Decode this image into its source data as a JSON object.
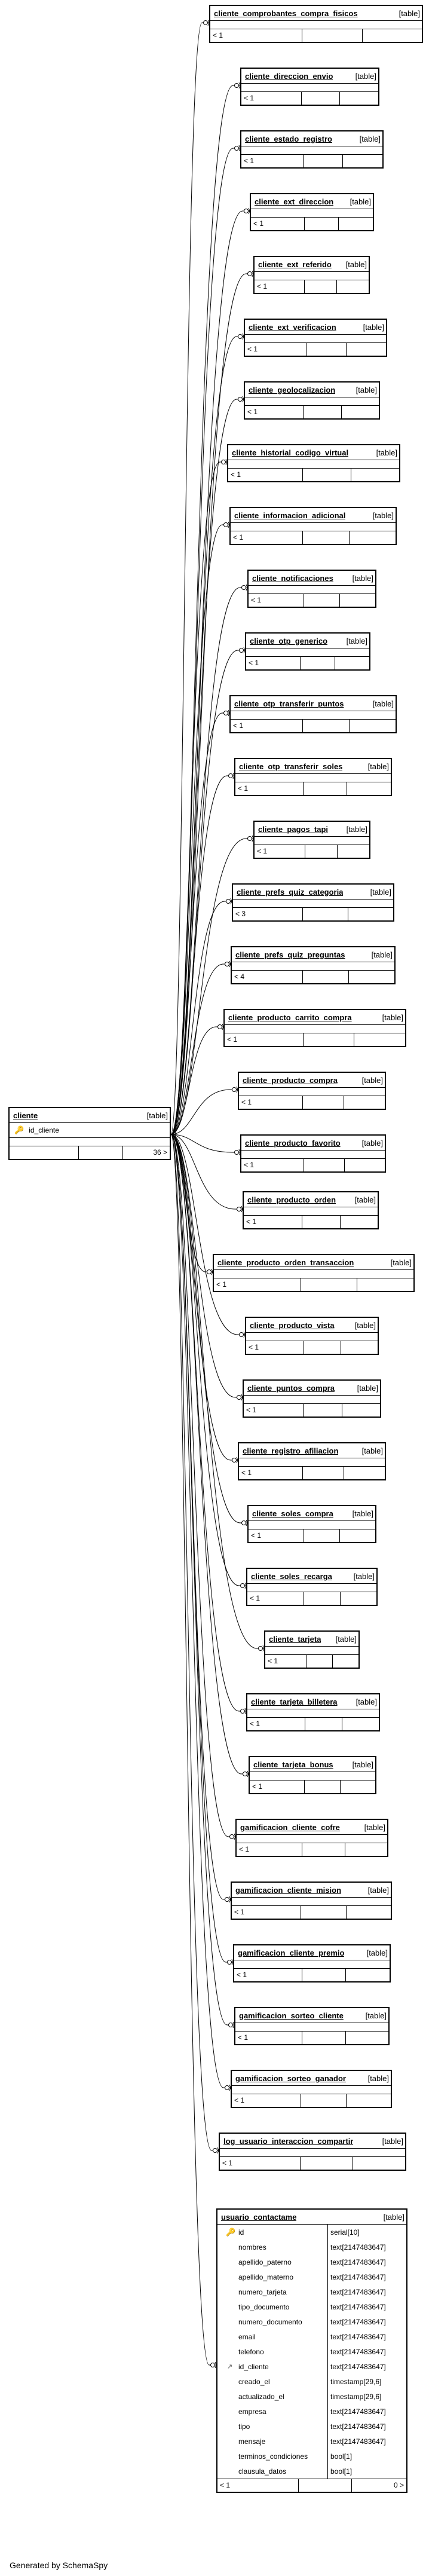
{
  "footer": {
    "generated_by": "Generated by SchemaSpy"
  },
  "cliente": {
    "name": "cliente",
    "tag": "[table]",
    "pk_column": "id_cliente",
    "children": "36 >"
  },
  "related": [
    {
      "name": "cliente_comprobantes_compra_fisicos",
      "tag": "[table]",
      "parents": "< 1"
    },
    {
      "name": "cliente_direccion_envio",
      "tag": "[table]",
      "parents": "< 1"
    },
    {
      "name": "cliente_estado_registro",
      "tag": "[table]",
      "parents": "< 1"
    },
    {
      "name": "cliente_ext_direccion",
      "tag": "[table]",
      "parents": "< 1"
    },
    {
      "name": "cliente_ext_referido",
      "tag": "[table]",
      "parents": "< 1"
    },
    {
      "name": "cliente_ext_verificacion",
      "tag": "[table]",
      "parents": "< 1"
    },
    {
      "name": "cliente_geolocalizacion",
      "tag": "[table]",
      "parents": "< 1"
    },
    {
      "name": "cliente_historial_codigo_virtual",
      "tag": "[table]",
      "parents": "< 1"
    },
    {
      "name": "cliente_informacion_adicional",
      "tag": "[table]",
      "parents": "< 1"
    },
    {
      "name": "cliente_notificaciones",
      "tag": "[table]",
      "parents": "< 1"
    },
    {
      "name": "cliente_otp_generico",
      "tag": "[table]",
      "parents": "< 1"
    },
    {
      "name": "cliente_otp_transferir_puntos",
      "tag": "[table]",
      "parents": "< 1"
    },
    {
      "name": "cliente_otp_transferir_soles",
      "tag": "[table]",
      "parents": "< 1"
    },
    {
      "name": "cliente_pagos_tapi",
      "tag": "[table]",
      "parents": "< 1"
    },
    {
      "name": "cliente_prefs_quiz_categoria",
      "tag": "[table]",
      "parents": "< 3"
    },
    {
      "name": "cliente_prefs_quiz_preguntas",
      "tag": "[table]",
      "parents": "< 4"
    },
    {
      "name": "cliente_producto_carrito_compra",
      "tag": "[table]",
      "parents": "< 1"
    },
    {
      "name": "cliente_producto_compra",
      "tag": "[table]",
      "parents": "< 1"
    },
    {
      "name": "cliente_producto_favorito",
      "tag": "[table]",
      "parents": "< 1"
    },
    {
      "name": "cliente_producto_orden",
      "tag": "[table]",
      "parents": "< 1"
    },
    {
      "name": "cliente_producto_orden_transaccion",
      "tag": "[table]",
      "parents": "< 1"
    },
    {
      "name": "cliente_producto_vista",
      "tag": "[table]",
      "parents": "< 1"
    },
    {
      "name": "cliente_puntos_compra",
      "tag": "[table]",
      "parents": "< 1"
    },
    {
      "name": "cliente_registro_afiliacion",
      "tag": "[table]",
      "parents": "< 1"
    },
    {
      "name": "cliente_soles_compra",
      "tag": "[table]",
      "parents": "< 1"
    },
    {
      "name": "cliente_soles_recarga",
      "tag": "[table]",
      "parents": "< 1"
    },
    {
      "name": "cliente_tarjeta",
      "tag": "[table]",
      "parents": "< 1"
    },
    {
      "name": "cliente_tarjeta_billetera",
      "tag": "[table]",
      "parents": "< 1"
    },
    {
      "name": "cliente_tarjeta_bonus",
      "tag": "[table]",
      "parents": "< 1"
    },
    {
      "name": "gamificacion_cliente_cofre",
      "tag": "[table]",
      "parents": "< 1"
    },
    {
      "name": "gamificacion_cliente_mision",
      "tag": "[table]",
      "parents": "< 1"
    },
    {
      "name": "gamificacion_cliente_premio",
      "tag": "[table]",
      "parents": "< 1"
    },
    {
      "name": "gamificacion_sorteo_cliente",
      "tag": "[table]",
      "parents": "< 1"
    },
    {
      "name": "gamificacion_sorteo_ganador",
      "tag": "[table]",
      "parents": "< 1"
    },
    {
      "name": "log_usuario_interaccion_compartir",
      "tag": "[table]",
      "parents": "< 1"
    }
  ],
  "usuario": {
    "name": "usuario_contactame",
    "tag": "[table]",
    "columns": [
      {
        "name": "id",
        "type": "serial[10]",
        "key": "pk"
      },
      {
        "name": "nombres",
        "type": "text[2147483647]",
        "key": ""
      },
      {
        "name": "apellido_paterno",
        "type": "text[2147483647]",
        "key": ""
      },
      {
        "name": "apellido_materno",
        "type": "text[2147483647]",
        "key": ""
      },
      {
        "name": "numero_tarjeta",
        "type": "text[2147483647]",
        "key": ""
      },
      {
        "name": "tipo_documento",
        "type": "text[2147483647]",
        "key": ""
      },
      {
        "name": "numero_documento",
        "type": "text[2147483647]",
        "key": ""
      },
      {
        "name": "email",
        "type": "text[2147483647]",
        "key": ""
      },
      {
        "name": "telefono",
        "type": "text[2147483647]",
        "key": ""
      },
      {
        "name": "id_cliente",
        "type": "text[2147483647]",
        "key": "fk"
      },
      {
        "name": "creado_el",
        "type": "timestamp[29,6]",
        "key": ""
      },
      {
        "name": "actualizado_el",
        "type": "timestamp[29,6]",
        "key": ""
      },
      {
        "name": "empresa",
        "type": "text[2147483647]",
        "key": ""
      },
      {
        "name": "tipo",
        "type": "text[2147483647]",
        "key": ""
      },
      {
        "name": "mensaje",
        "type": "text[2147483647]",
        "key": ""
      },
      {
        "name": "terminos_condiciones",
        "type": "bool[1]",
        "key": ""
      },
      {
        "name": "clausula_datos",
        "type": "bool[1]",
        "key": ""
      }
    ],
    "parents": "< 1",
    "children": "0 >"
  }
}
